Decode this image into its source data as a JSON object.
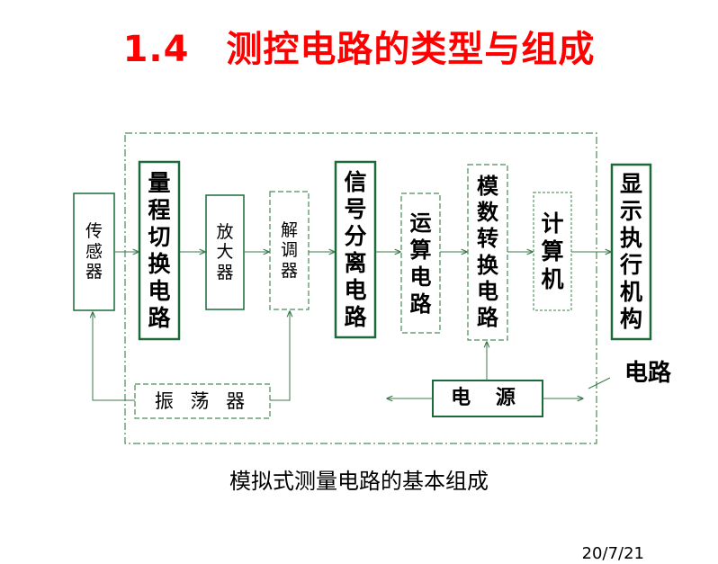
{
  "title": "1.4　测控电路的类型与组成",
  "caption": "模拟式测量电路的基本组成",
  "date": "20/7/21",
  "side_label": "电路",
  "blocks": {
    "sensor": "传\n感\n器",
    "range_switch": "量\n程\n切\n换\n电\n路",
    "amplifier": "放\n大\n器",
    "demodulator": "解\n调\n器",
    "signal_separation": "信\n号\n分\n离\n电\n路",
    "operation_circuit": "运\n算\n电\n路",
    "adc_circuit": "模\n数\n转\n换\n电\n路",
    "computer": "计\n算\n机",
    "display_actuator": "显\n示\n执\n行\n机\n构",
    "oscillator": "振 荡 器",
    "power_supply": "电 源"
  },
  "colors": {
    "title": "#ff0000",
    "box": "#1a6a3a",
    "dashed": "#4a8a5a",
    "arrow": "#3a7a4a"
  }
}
